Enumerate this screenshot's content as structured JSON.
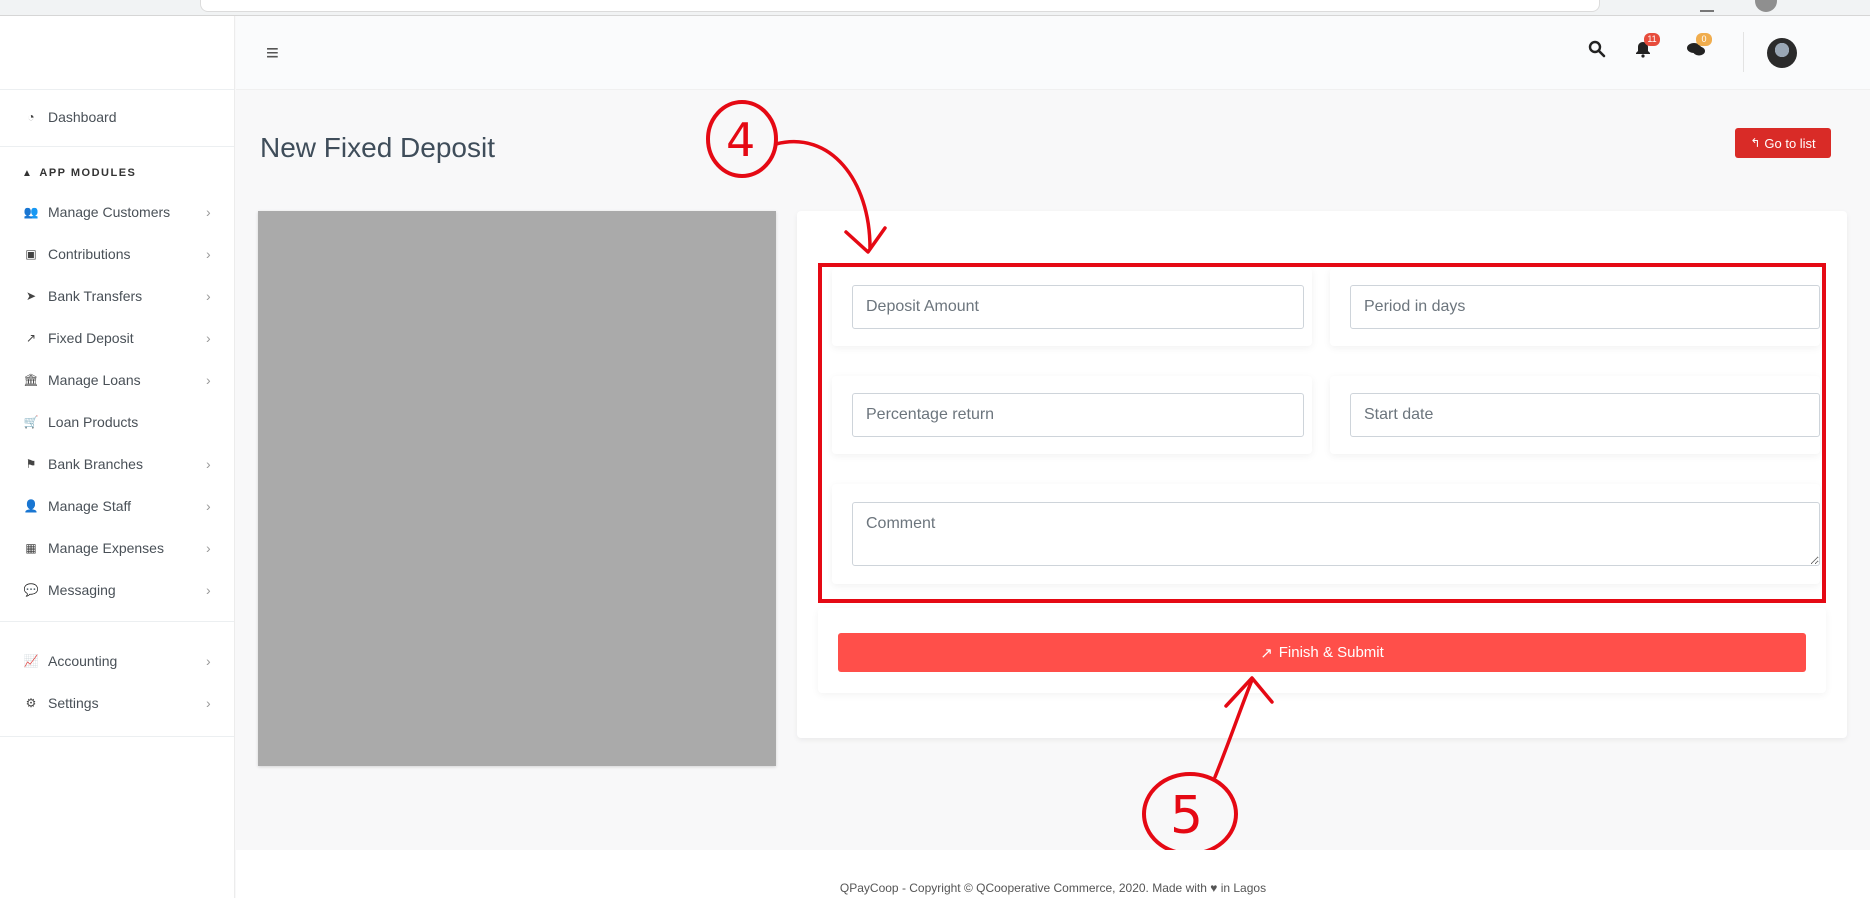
{
  "sidebar": {
    "dashboard": {
      "label": "Dashboard",
      "icon": "dashboard-icon"
    },
    "section_label": "APP MODULES",
    "modules": [
      {
        "label": "Manage Customers",
        "icon": "users-icon",
        "has_submenu": true
      },
      {
        "label": "Contributions",
        "icon": "money-icon",
        "has_submenu": true
      },
      {
        "label": "Bank Transfers",
        "icon": "paper-plane-icon",
        "has_submenu": true
      },
      {
        "label": "Fixed Deposit",
        "icon": "gavel-icon",
        "has_submenu": true
      },
      {
        "label": "Manage Loans",
        "icon": "bank-icon",
        "has_submenu": true
      },
      {
        "label": "Loan Products",
        "icon": "cart-icon",
        "has_submenu": false
      },
      {
        "label": "Bank Branches",
        "icon": "flag-icon",
        "has_submenu": true
      },
      {
        "label": "Manage Staff",
        "icon": "user-icon",
        "has_submenu": true
      },
      {
        "label": "Manage Expenses",
        "icon": "calculator-icon",
        "has_submenu": true
      },
      {
        "label": "Messaging",
        "icon": "comments-icon",
        "has_submenu": true
      }
    ],
    "bottom": [
      {
        "label": "Accounting",
        "icon": "chart-icon",
        "has_submenu": true
      },
      {
        "label": "Settings",
        "icon": "gear-icon",
        "has_submenu": true
      }
    ]
  },
  "header": {
    "notifications_count": "11",
    "messages_count": "0"
  },
  "page": {
    "title": "New Fixed Deposit",
    "go_to_list_label": "Go to list"
  },
  "form": {
    "deposit_amount_placeholder": "Deposit Amount",
    "period_placeholder": "Period in days",
    "percentage_placeholder": "Percentage return",
    "start_date_placeholder": "Start date",
    "comment_placeholder": "Comment",
    "submit_label": "Finish & Submit"
  },
  "annotations": {
    "step_a": "4",
    "step_b": "5"
  },
  "footer": {
    "text": "QPayCoop - Copyright © QCooperative Commerce, 2020. Made with ♥ in Lagos"
  },
  "colors": {
    "accent_red": "#ff4f4a",
    "go_list_red": "#d92b27",
    "annotation_red": "#e50914",
    "badge_red": "#e74c3c",
    "badge_orange": "#f0ad4e"
  }
}
